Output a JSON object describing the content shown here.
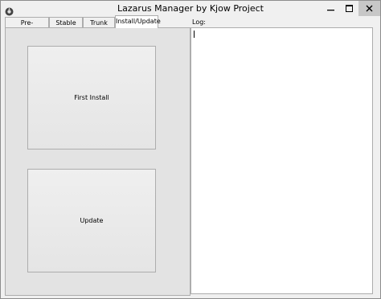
{
  "window": {
    "title": "Lazarus Manager by Kjow Project",
    "controls": {
      "minimize_icon": "minimize-icon",
      "maximize_icon": "maximize-icon",
      "close_icon": "close-icon"
    }
  },
  "tabs": [
    {
      "label": "Pre-Installation",
      "active": false
    },
    {
      "label": "Stable Tree",
      "active": false
    },
    {
      "label": "Trunk Tree",
      "active": false
    },
    {
      "label": "Install/Update",
      "active": true
    }
  ],
  "install_panel": {
    "first_install_label": "First Install",
    "update_label": "Update"
  },
  "log": {
    "label": "Log:",
    "content": ""
  },
  "colors": {
    "close_button_bg": "#c7c7c7",
    "panel_bg": "#e3e3e3",
    "window_bg": "#f0f0f0"
  }
}
